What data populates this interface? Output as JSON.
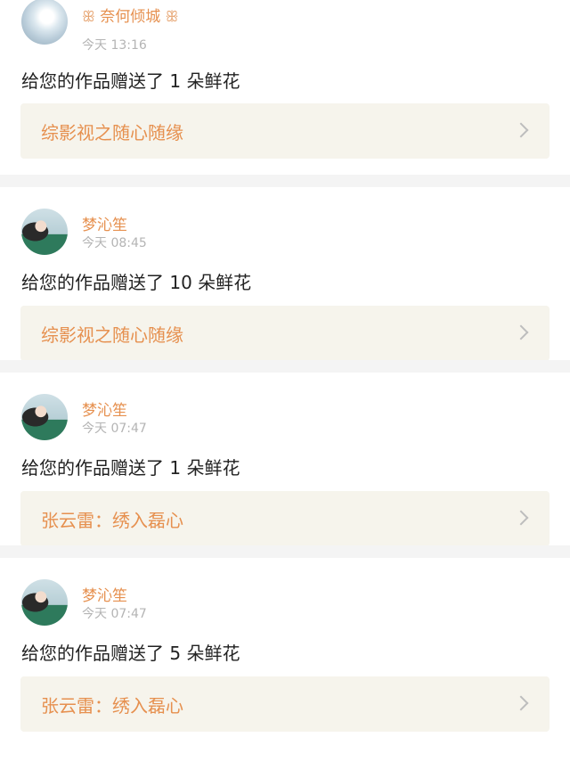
{
  "notifications": [
    {
      "username": "奈何倾城",
      "username_decor_left": "ꕥ",
      "username_decor_right": "ꕥ",
      "time": "今天 13:16",
      "message": "给您的作品赠送了 1 朵鲜花",
      "work_title": "综影视之随心随缘",
      "avatar": "avatar-white-hair"
    },
    {
      "username": "梦沁笙",
      "time": "今天 08:45",
      "message": "给您的作品赠送了 10 朵鲜花",
      "work_title": "综影视之随心随缘",
      "avatar": "avatar-girl"
    },
    {
      "username": "梦沁笙",
      "time": "今天 07:47",
      "message": "给您的作品赠送了 1 朵鲜花",
      "work_title": "张云雷：绣入磊心",
      "avatar": "avatar-girl"
    },
    {
      "username": "梦沁笙",
      "time": "今天 07:47",
      "message": "给您的作品赠送了 5 朵鲜花",
      "work_title": "张云雷：绣入磊心",
      "avatar": "avatar-girl"
    }
  ],
  "colors": {
    "accent": "#e6904f",
    "link_bg": "#f6f4ec",
    "time": "#b4b4b4",
    "separator": "#f4f4f4"
  },
  "icons": {
    "chevron": "chevron-right-icon"
  }
}
